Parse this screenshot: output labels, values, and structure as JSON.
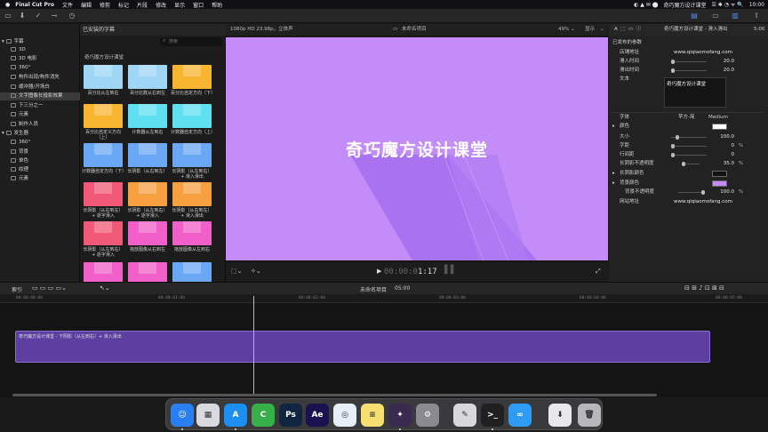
{
  "menubar": {
    "app": "Final Cut Pro",
    "items": [
      "文件",
      "编辑",
      "修剪",
      "标记",
      "片段",
      "修改",
      "显示",
      "窗口",
      "帮助"
    ],
    "window_title": "奇巧魔方设计课堂",
    "clock": "10:00"
  },
  "library": {
    "items": [
      {
        "label": "字幕",
        "indent": 0,
        "arrow": "▾"
      },
      {
        "label": "3D",
        "indent": 1
      },
      {
        "label": "3D 电影",
        "indent": 1
      },
      {
        "label": "360°",
        "indent": 1
      },
      {
        "label": "构件出现/构件消失",
        "indent": 1
      },
      {
        "label": "缓冲器/开场白",
        "indent": 1
      },
      {
        "label": "文字图像长投影效果",
        "indent": 1,
        "selected": true
      },
      {
        "label": "下三分之一",
        "indent": 1
      },
      {
        "label": "元素",
        "indent": 1
      },
      {
        "label": "制作人员",
        "indent": 1
      },
      {
        "label": "发生器",
        "indent": 0,
        "arrow": "▾"
      },
      {
        "label": "360°",
        "indent": 1
      },
      {
        "label": "背景",
        "indent": 1
      },
      {
        "label": "单色",
        "indent": 1
      },
      {
        "label": "纹理",
        "indent": 1
      },
      {
        "label": "元素",
        "indent": 1
      }
    ]
  },
  "browser": {
    "header": "已安装的字幕",
    "search_placeholder": "搜索",
    "group": "奇巧魔方设计课堂",
    "thumbs": [
      {
        "caption": "百分比从左到右",
        "color": "#9fd6f6"
      },
      {
        "caption": "百分比数从右到左",
        "color": "#9fd6f6"
      },
      {
        "caption": "百分比自定方向（下）",
        "color": "#f8b530"
      },
      {
        "caption": "百分比自定义方向（上）",
        "color": "#f8b530"
      },
      {
        "caption": "计数器从左到右",
        "color": "#5fe0f0"
      },
      {
        "caption": "计数器自定方向（上）",
        "color": "#5fe0f0"
      },
      {
        "caption": "计数器自定方向（下）",
        "color": "#6aa8f6"
      },
      {
        "caption": "长阴影（从右到左）",
        "color": "#6aa8f6"
      },
      {
        "caption": "长阴影（从左到右）+ 滑入滑出",
        "color": "#6aa8f6"
      },
      {
        "caption": "长阴影（从右到左）+ 逐字滑入",
        "color": "#f05a78"
      },
      {
        "caption": "长阴影（从左到右）+ 逐字滑入",
        "color": "#f8a040"
      },
      {
        "caption": "长阴影（从右到左）+ 滑入滑出",
        "color": "#f8a040"
      },
      {
        "caption": "长阴影（从左到右）+ 逐字滑入",
        "color": "#f05a78"
      },
      {
        "caption": "拖放图像从右到左",
        "color": "#f060c8"
      },
      {
        "caption": "拖放图像从左到右",
        "color": "#f060c8"
      },
      {
        "caption": "",
        "color": "#f060c8"
      },
      {
        "caption": "",
        "color": "#f060c8"
      },
      {
        "caption": "",
        "color": "#6aa8f6"
      }
    ]
  },
  "viewer": {
    "format": "1080p HD 23.98p，立体声",
    "project": "未命名项目",
    "zoom": "49%",
    "view_menu": "显示",
    "title_text": "奇巧魔方设计课堂",
    "timecode_dim": "00:00:0",
    "timecode": "1:17",
    "bg_color": "#c38cf8"
  },
  "inspector": {
    "header_title": "奇巧魔方设计课堂 - 滑入滑出",
    "header_time": "5:00",
    "section": "已发布的参数",
    "shop_label": "店铺地址",
    "shop_value": "www.qiqiaomofang.com",
    "in_label": "滑入时间",
    "in_value": "20.0",
    "out_label": "滑出时间",
    "out_value": "20.0",
    "text_label": "文本",
    "text_value": "奇巧魔方设计课堂",
    "font_label": "字体",
    "font_value": "苹方-简",
    "font_weight": "Medium",
    "color_label": "颜色",
    "size_label": "大小",
    "size_value": "100.0",
    "tracking_label": "字距",
    "tracking_value": "0",
    "tracking_unit": "%",
    "leading_label": "行间距",
    "leading_value": "0",
    "shadow_opacity_label": "长阴影不透明度",
    "shadow_opacity_value": "35.0",
    "shadow_opacity_unit": "%",
    "shadow_color_label": "长阴影颜色",
    "bg_color_label": "背景颜色",
    "bg_opacity_label": "背景不透明度",
    "bg_opacity_value": "100.0",
    "bg_opacity_unit": "%",
    "site_label": "网站地址",
    "site_value": "www.qiqiaomofang.com"
  },
  "timeline": {
    "index_label": "索引",
    "project": "未命名项目",
    "duration": "05:00",
    "ruler": [
      "00:00:00:00",
      "00:00:01:00",
      "00:00:02:00",
      "00:00:03:00",
      "00:00:04:00",
      "00:00:05:00"
    ],
    "clip_label": "奇巧魔方设计课堂 - 下阴影（从左到右）+ 滑入滑出"
  },
  "dock": {
    "apps": [
      {
        "name": "finder",
        "color": "#2a7ff0",
        "glyph": "☺"
      },
      {
        "name": "launchpad",
        "color": "#d9d9e0",
        "glyph": "▦"
      },
      {
        "name": "app-store",
        "color": "#1d8ff0",
        "glyph": "A"
      },
      {
        "name": "coda",
        "color": "#37b04a",
        "glyph": "C"
      },
      {
        "name": "photoshop",
        "color": "#0f2540",
        "glyph": "Ps"
      },
      {
        "name": "after-effects",
        "color": "#1a1250",
        "glyph": "Ae"
      },
      {
        "name": "safari",
        "color": "#e6eef8",
        "glyph": "◎"
      },
      {
        "name": "notes",
        "color": "#f8e070",
        "glyph": "≡"
      },
      {
        "name": "final-cut-pro",
        "color": "#3a2a50",
        "glyph": "✦"
      },
      {
        "name": "system-preferences",
        "color": "#8a8a90",
        "glyph": "⚙"
      },
      {
        "name": "script-editor",
        "color": "#d8d8dc",
        "glyph": "✎"
      },
      {
        "name": "terminal",
        "color": "#202020",
        "glyph": ">_"
      },
      {
        "name": "baidu-netdisk",
        "color": "#2f9cf4",
        "glyph": "∞"
      },
      {
        "name": "downloads",
        "color": "#e8e8ec",
        "glyph": "⬇"
      },
      {
        "name": "trash",
        "color": "#b8b8bc",
        "glyph": "🗑"
      }
    ]
  }
}
